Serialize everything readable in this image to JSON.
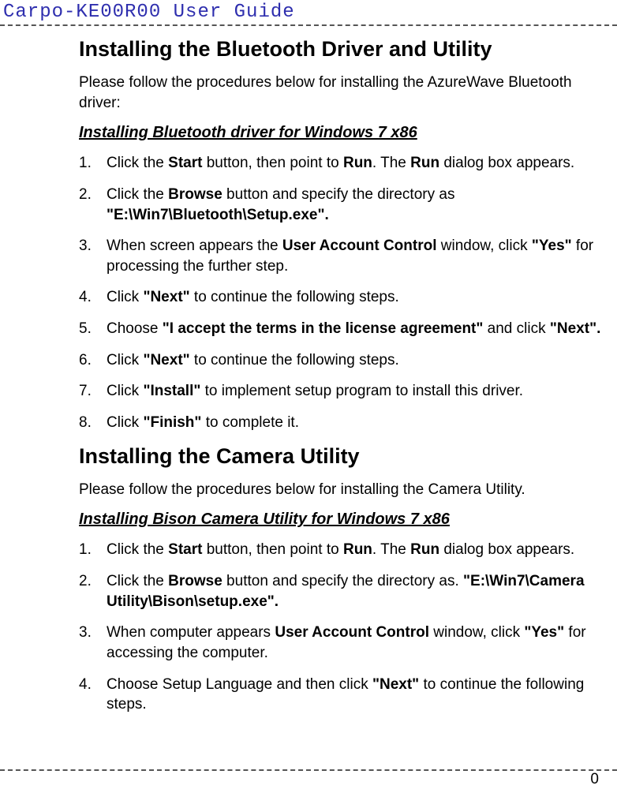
{
  "header": "Carpo-KE00R00 User Guide",
  "section1": {
    "heading": "Installing the Bluetooth Driver and Utility",
    "intro": "Please follow the procedures below for installing the AzureWave Bluetooth driver:",
    "subheading": "Installing Bluetooth driver for Windows 7 x86",
    "steps": [
      {
        "n": "1.",
        "html": "Click the <b>Start</b> button, then point to <b>Run</b>. The <b>Run</b> dialog box appears."
      },
      {
        "n": "2.",
        "html": "Click the <b>Browse</b> button and specify the directory as <b>\"E:\\Win7\\Bluetooth\\Setup.exe\".</b>"
      },
      {
        "n": "3.",
        "html": "When screen appears the <b>User Account Control</b> window, click <b>\"Yes\"</b> for processing the further step."
      },
      {
        "n": "4.",
        "html": "Click <b>\"Next\"</b> to continue the following steps."
      },
      {
        "n": "5.",
        "html": "Choose <b>\"I accept the terms in the license agreement\"</b> and click <b>\"Next\".</b>"
      },
      {
        "n": "6.",
        "html": "Click <b>\"Next\"</b> to continue the following steps."
      },
      {
        "n": "7.",
        "html": "Click <b>\"Install\"</b> to implement setup program to install this driver."
      },
      {
        "n": "8.",
        "html": "Click <b>\"Finish\"</b> to complete it."
      }
    ]
  },
  "section2": {
    "heading": "Installing the Camera Utility",
    "intro": "Please follow the procedures below for installing the Camera Utility.",
    "subheading": "Installing Bison Camera Utility for Windows 7 x86",
    "steps": [
      {
        "n": "1.",
        "html": "Click the <b>Start</b> button, then point to <b>Run</b>. The <b>Run</b> dialog box appears."
      },
      {
        "n": "2.",
        "html": "Click the <b>Browse</b> button and specify the directory as. <b>\"E:\\Win7\\Camera Utility\\Bison\\setup.exe\".</b>"
      },
      {
        "n": "3.",
        "html": "When computer appears <b>User Account Control</b> window, click <b>\"Yes\"</b> for accessing the computer."
      },
      {
        "n": "4.",
        "html": "Choose Setup Language and then click <b>\"Next\"</b> to continue the following steps."
      }
    ]
  },
  "pageNumber": "0"
}
